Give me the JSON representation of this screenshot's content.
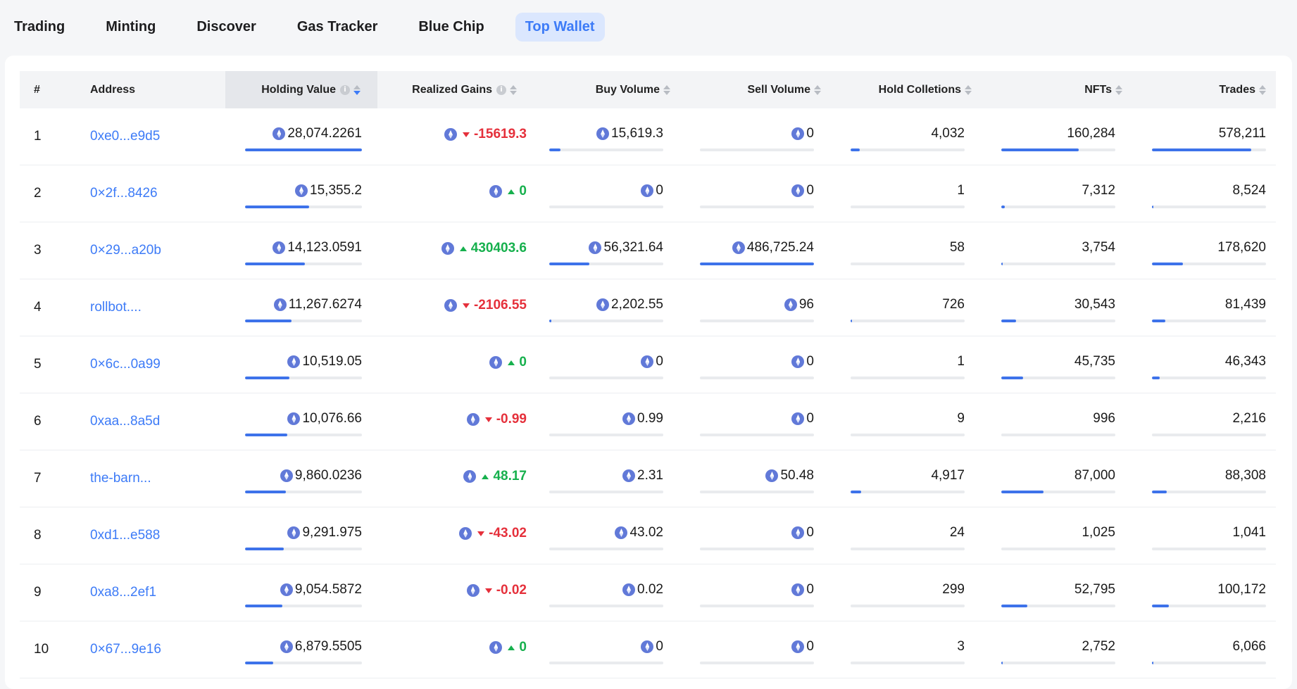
{
  "tabs": [
    {
      "label": "Trading",
      "active": false
    },
    {
      "label": "Minting",
      "active": false
    },
    {
      "label": "Discover",
      "active": false
    },
    {
      "label": "Gas Tracker",
      "active": false
    },
    {
      "label": "Blue Chip",
      "active": false
    },
    {
      "label": "Top Wallet",
      "active": true
    }
  ],
  "colors": {
    "accent": "#3d7bf7",
    "gain_positive": "#16b04d",
    "gain_negative": "#e5303b",
    "eth_icon": "#6179d8"
  },
  "table": {
    "headers": {
      "rank": "#",
      "address": "Address",
      "holding_value": "Holding Value",
      "realized_gains": "Realized Gains",
      "buy_volume": "Buy Volume",
      "sell_volume": "Sell Volume",
      "hold_collections": "Hold Colletions",
      "nfts": "NFTs",
      "trades": "Trades"
    },
    "sort": {
      "column": "holding_value",
      "direction": "desc"
    },
    "rows": [
      {
        "rank": "1",
        "address": "0xe0...e9d5",
        "holding": "28,074.2261",
        "holding_pct": 100,
        "gain": "-15619.3",
        "gain_dir": "down",
        "buy": "15,619.3",
        "buy_pct": 10,
        "sell": "0",
        "sell_pct": 0,
        "collections": "4,032",
        "collections_pct": 8,
        "nfts": "160,284",
        "nfts_pct": 68,
        "trades": "578,211",
        "trades_pct": 87
      },
      {
        "rank": "2",
        "address": "0×2f...8426",
        "holding": "15,355.2",
        "holding_pct": 55,
        "gain": "0",
        "gain_dir": "up",
        "buy": "0",
        "buy_pct": 0,
        "sell": "0",
        "sell_pct": 0,
        "collections": "1",
        "collections_pct": 0,
        "nfts": "7,312",
        "nfts_pct": 3,
        "trades": "8,524",
        "trades_pct": 1.5
      },
      {
        "rank": "3",
        "address": "0×29...a20b",
        "holding": "14,123.0591",
        "holding_pct": 51,
        "gain": "430403.6",
        "gain_dir": "up",
        "buy": "56,321.64",
        "buy_pct": 35,
        "sell": "486,725.24",
        "sell_pct": 100,
        "collections": "58",
        "collections_pct": 0,
        "nfts": "3,754",
        "nfts_pct": 1.5,
        "trades": "178,620",
        "trades_pct": 27
      },
      {
        "rank": "4",
        "address": "rollbot....",
        "holding": "11,267.6274",
        "holding_pct": 40,
        "gain": "-2106.55",
        "gain_dir": "down",
        "buy": "2,202.55",
        "buy_pct": 2,
        "sell": "96",
        "sell_pct": 0,
        "collections": "726",
        "collections_pct": 1.5,
        "nfts": "30,543",
        "nfts_pct": 13,
        "trades": "81,439",
        "trades_pct": 12
      },
      {
        "rank": "5",
        "address": "0×6c...0a99",
        "holding": "10,519.05",
        "holding_pct": 38,
        "gain": "0",
        "gain_dir": "up",
        "buy": "0",
        "buy_pct": 0,
        "sell": "0",
        "sell_pct": 0,
        "collections": "1",
        "collections_pct": 0,
        "nfts": "45,735",
        "nfts_pct": 19,
        "trades": "46,343",
        "trades_pct": 7
      },
      {
        "rank": "6",
        "address": "0xaa...8a5d",
        "holding": "10,076.66",
        "holding_pct": 36,
        "gain": "-0.99",
        "gain_dir": "down",
        "buy": "0.99",
        "buy_pct": 0,
        "sell": "0",
        "sell_pct": 0,
        "collections": "9",
        "collections_pct": 0,
        "nfts": "996",
        "nfts_pct": 0,
        "trades": "2,216",
        "trades_pct": 0
      },
      {
        "rank": "7",
        "address": "the-barn...",
        "holding": "9,860.0236",
        "holding_pct": 35,
        "gain": "48.17",
        "gain_dir": "up",
        "buy": "2.31",
        "buy_pct": 0,
        "sell": "50.48",
        "sell_pct": 0,
        "collections": "4,917",
        "collections_pct": 9,
        "nfts": "87,000",
        "nfts_pct": 37,
        "trades": "88,308",
        "trades_pct": 13
      },
      {
        "rank": "8",
        "address": "0xd1...e588",
        "holding": "9,291.975",
        "holding_pct": 33,
        "gain": "-43.02",
        "gain_dir": "down",
        "buy": "43.02",
        "buy_pct": 0,
        "sell": "0",
        "sell_pct": 0,
        "collections": "24",
        "collections_pct": 0,
        "nfts": "1,025",
        "nfts_pct": 0,
        "trades": "1,041",
        "trades_pct": 0
      },
      {
        "rank": "9",
        "address": "0xa8...2ef1",
        "holding": "9,054.5872",
        "holding_pct": 32,
        "gain": "-0.02",
        "gain_dir": "down",
        "buy": "0.02",
        "buy_pct": 0,
        "sell": "0",
        "sell_pct": 0,
        "collections": "299",
        "collections_pct": 0,
        "nfts": "52,795",
        "nfts_pct": 23,
        "trades": "100,172",
        "trades_pct": 15
      },
      {
        "rank": "10",
        "address": "0×67...9e16",
        "holding": "6,879.5505",
        "holding_pct": 24,
        "gain": "0",
        "gain_dir": "up",
        "buy": "0",
        "buy_pct": 0,
        "sell": "0",
        "sell_pct": 0,
        "collections": "3",
        "collections_pct": 0,
        "nfts": "2,752",
        "nfts_pct": 1,
        "trades": "6,066",
        "trades_pct": 1
      }
    ]
  }
}
